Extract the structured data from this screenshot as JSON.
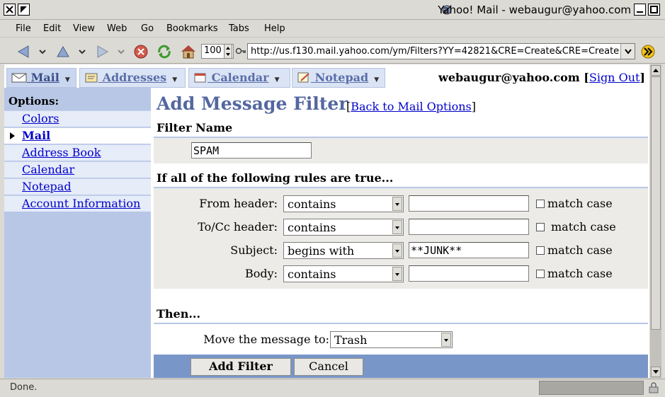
{
  "window": {
    "title": "Yahoo! Mail - webaugur@yahoo.com"
  },
  "menu": {
    "items": [
      "File",
      "Edit",
      "View",
      "Web",
      "Go",
      "Bookmarks",
      "Tabs",
      "Help"
    ]
  },
  "toolbar": {
    "zoom": "100",
    "url": "http://us.f130.mail.yahoo.com/ym/Filters?YY=42821&CRE=Create&CRE=Create",
    "icons": [
      "back-icon",
      "up-icon",
      "forward-icon",
      "stop-icon",
      "reload-icon",
      "home-icon",
      "go-icon"
    ]
  },
  "tabs": [
    {
      "label": "Mail",
      "icon": "envelope-icon"
    },
    {
      "label": "Addresses",
      "icon": "address-book-icon"
    },
    {
      "label": "Calendar",
      "icon": "calendar-icon"
    },
    {
      "label": "Notepad",
      "icon": "notepad-icon"
    }
  ],
  "user": {
    "email": "webaugur@yahoo.com",
    "sign_out": "Sign Out"
  },
  "sidebar": {
    "title": "Options:",
    "items": [
      "Colors",
      "Mail",
      "Address Book",
      "Calendar",
      "Notepad",
      "Account Information"
    ],
    "active": "Mail"
  },
  "form": {
    "title": "Add Message Filter",
    "back_link": "Back to Mail Options",
    "filter_name_heading": "Filter Name",
    "filter_name_value": "SPAM",
    "rules_heading": "If all of the following rules are true...",
    "rules": [
      {
        "label": "From header:",
        "operator": "contains",
        "value": "",
        "match_case": "match case"
      },
      {
        "label": "To/Cc header:",
        "operator": "contains",
        "value": "",
        "match_case": "match case"
      },
      {
        "label": "Subject:",
        "operator": "begins with",
        "value": "**JUNK**",
        "match_case": "match case"
      },
      {
        "label": "Body:",
        "operator": "contains",
        "value": "",
        "match_case": "match case"
      }
    ],
    "then_heading": "Then...",
    "move_label": "Move the message to:",
    "move_target": "Trash",
    "add_button": "Add Filter",
    "cancel_button": "Cancel"
  },
  "status": {
    "text": "Done."
  }
}
